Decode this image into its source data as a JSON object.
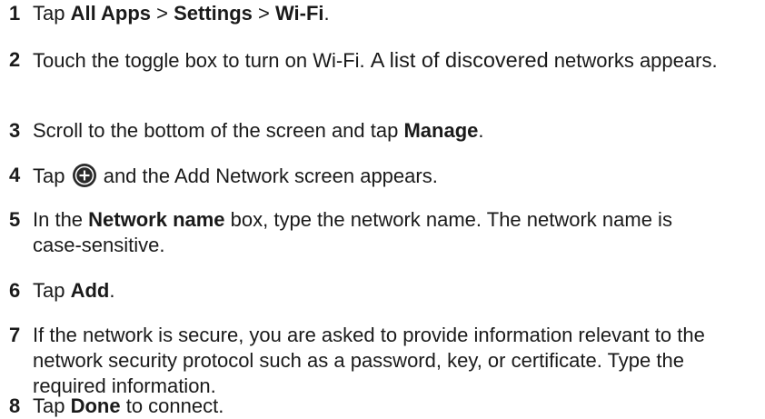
{
  "steps": [
    {
      "num": "1",
      "parts": [
        {
          "t": "Tap ",
          "b": false
        },
        {
          "t": "All Apps",
          "b": true
        },
        {
          "t": " > ",
          "b": false
        },
        {
          "t": "Settings",
          "b": true
        },
        {
          "t": " > ",
          "b": false
        },
        {
          "t": "Wi-Fi",
          "b": true
        },
        {
          "t": ".",
          "b": false
        }
      ]
    },
    {
      "num": "2",
      "parts": [
        {
          "t": "Touch the toggle box to turn on Wi-Fi. ",
          "b": false
        },
        {
          "t": "A list of discovered",
          "b": false,
          "big": true
        },
        {
          "t": " networks appears.",
          "b": false
        }
      ]
    },
    {
      "num": "3",
      "parts": [
        {
          "t": "Scroll to the bottom of the screen and tap ",
          "b": false
        },
        {
          "t": "Manage",
          "b": true
        },
        {
          "t": ".",
          "b": false
        }
      ]
    },
    {
      "num": "4",
      "parts": [
        {
          "t": "Tap ",
          "b": false
        },
        {
          "icon": "add-circle-icon"
        },
        {
          "t": " and the Add Network screen appears.",
          "b": false
        }
      ]
    },
    {
      "num": "5",
      "parts": [
        {
          "t": "In the ",
          "b": false
        },
        {
          "t": "Network name",
          "b": true
        },
        {
          "t": " box, type the network name. The network name is case-sensitive.",
          "b": false
        }
      ]
    },
    {
      "num": "6",
      "parts": [
        {
          "t": "Tap ",
          "b": false
        },
        {
          "t": "Add",
          "b": true
        },
        {
          "t": ".",
          "b": false
        }
      ]
    },
    {
      "num": "7",
      "parts": [
        {
          "t": "If the network is secure, you are asked to provide information relevant to the network security protocol such as a password, key, or certificate. Type the required information.",
          "b": false
        }
      ]
    },
    {
      "num": "8",
      "parts": [
        {
          "t": "Tap ",
          "b": false
        },
        {
          "t": "Done",
          "b": true
        },
        {
          "t": " to connect.",
          "b": false
        }
      ]
    }
  ]
}
